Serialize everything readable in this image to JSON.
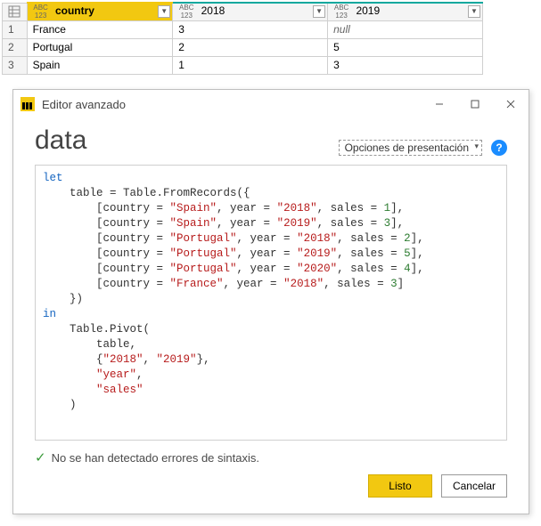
{
  "table": {
    "columns": [
      "country",
      "2018",
      "2019"
    ],
    "type_label": {
      "top": "ABC",
      "bot": "123"
    },
    "rows": [
      {
        "n": "1",
        "country": "France",
        "y2018": "3",
        "y2019": "null",
        "y2019_is_null": true
      },
      {
        "n": "2",
        "country": "Portugal",
        "y2018": "2",
        "y2019": "5"
      },
      {
        "n": "3",
        "country": "Spain",
        "y2018": "1",
        "y2019": "3"
      }
    ]
  },
  "dialog": {
    "title": "Editor avanzado",
    "heading": "data",
    "display_options": "Opciones de presentación",
    "help": "?",
    "syntax_msg": "No se han detectado errores de sintaxis.",
    "btn_done": "Listo",
    "btn_cancel": "Cancelar"
  },
  "code": {
    "let": "let",
    "in": "in",
    "table_assign_prefix": "    table = Table.FromRecords({",
    "records": [
      {
        "country": "\"Spain\"",
        "year": "\"2018\"",
        "sales": "1",
        "trail": ","
      },
      {
        "country": "\"Spain\"",
        "year": "\"2019\"",
        "sales": "3",
        "trail": ","
      },
      {
        "country": "\"Portugal\"",
        "year": "\"2018\"",
        "sales": "2",
        "trail": ","
      },
      {
        "country": "\"Portugal\"",
        "year": "\"2019\"",
        "sales": "5",
        "trail": ","
      },
      {
        "country": "\"Portugal\"",
        "year": "\"2020\"",
        "sales": "4",
        "trail": ","
      },
      {
        "country": "\"France\"",
        "year": "\"2018\"",
        "sales": "3",
        "trail": ""
      }
    ],
    "close_records": "    })",
    "pivot_open": "    Table.Pivot(",
    "pivot_arg_table": "        table,",
    "pivot_arg_list_open": "        {",
    "pivot_list_items": [
      "\"2018\"",
      "\"2019\""
    ],
    "pivot_arg_list_close": "},",
    "pivot_arg_year": "\"year\"",
    "pivot_arg_sales": "\"sales\"",
    "pivot_close": "    )"
  }
}
